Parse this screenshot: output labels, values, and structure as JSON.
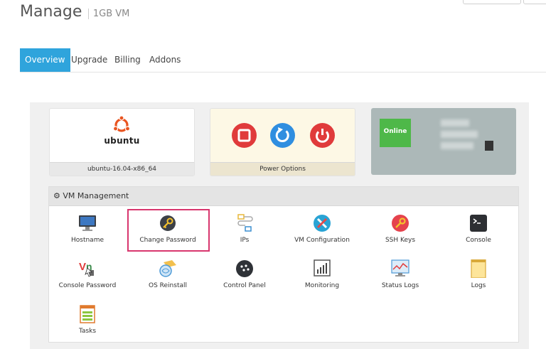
{
  "page": {
    "title": "Manage",
    "subtitle": "1GB VM"
  },
  "tabs": [
    {
      "label": "Overview",
      "active": true
    },
    {
      "label": "Upgrade",
      "active": false
    },
    {
      "label": "Billing",
      "active": false
    },
    {
      "label": "Addons",
      "active": false
    }
  ],
  "os_card": {
    "logo_text": "ubuntu",
    "os_name": "ubuntu-16.04-x86_64"
  },
  "power_card": {
    "footer_label": "Power Options",
    "buttons": [
      "stop-icon",
      "restart-icon",
      "power-icon"
    ]
  },
  "status_card": {
    "status": "Online"
  },
  "vm_management": {
    "title": "VM Management",
    "items": [
      {
        "label": "Hostname",
        "icon": "monitor-icon"
      },
      {
        "label": "Change Password",
        "icon": "key-icon"
      },
      {
        "label": "IPs",
        "icon": "network-icon"
      },
      {
        "label": "VM Configuration",
        "icon": "config-tools-icon"
      },
      {
        "label": "SSH Keys",
        "icon": "ssh-key-icon"
      },
      {
        "label": "Console",
        "icon": "terminal-icon"
      },
      {
        "label": "Console Password",
        "icon": "vnc-icon"
      },
      {
        "label": "OS Reinstall",
        "icon": "os-reinstall-icon"
      },
      {
        "label": "Control Panel",
        "icon": "control-panel-icon"
      },
      {
        "label": "Monitoring",
        "icon": "monitoring-icon"
      },
      {
        "label": "Status Logs",
        "icon": "status-logs-icon"
      },
      {
        "label": "Logs",
        "icon": "logs-icon"
      },
      {
        "label": "Tasks",
        "icon": "tasks-icon"
      }
    ]
  },
  "colors": {
    "accent": "#2fa4dc",
    "highlight": "#d8366e",
    "online": "#4eb849",
    "stop": "#e03b3b",
    "restart": "#2f8ee0",
    "power": "#e03b3b"
  }
}
